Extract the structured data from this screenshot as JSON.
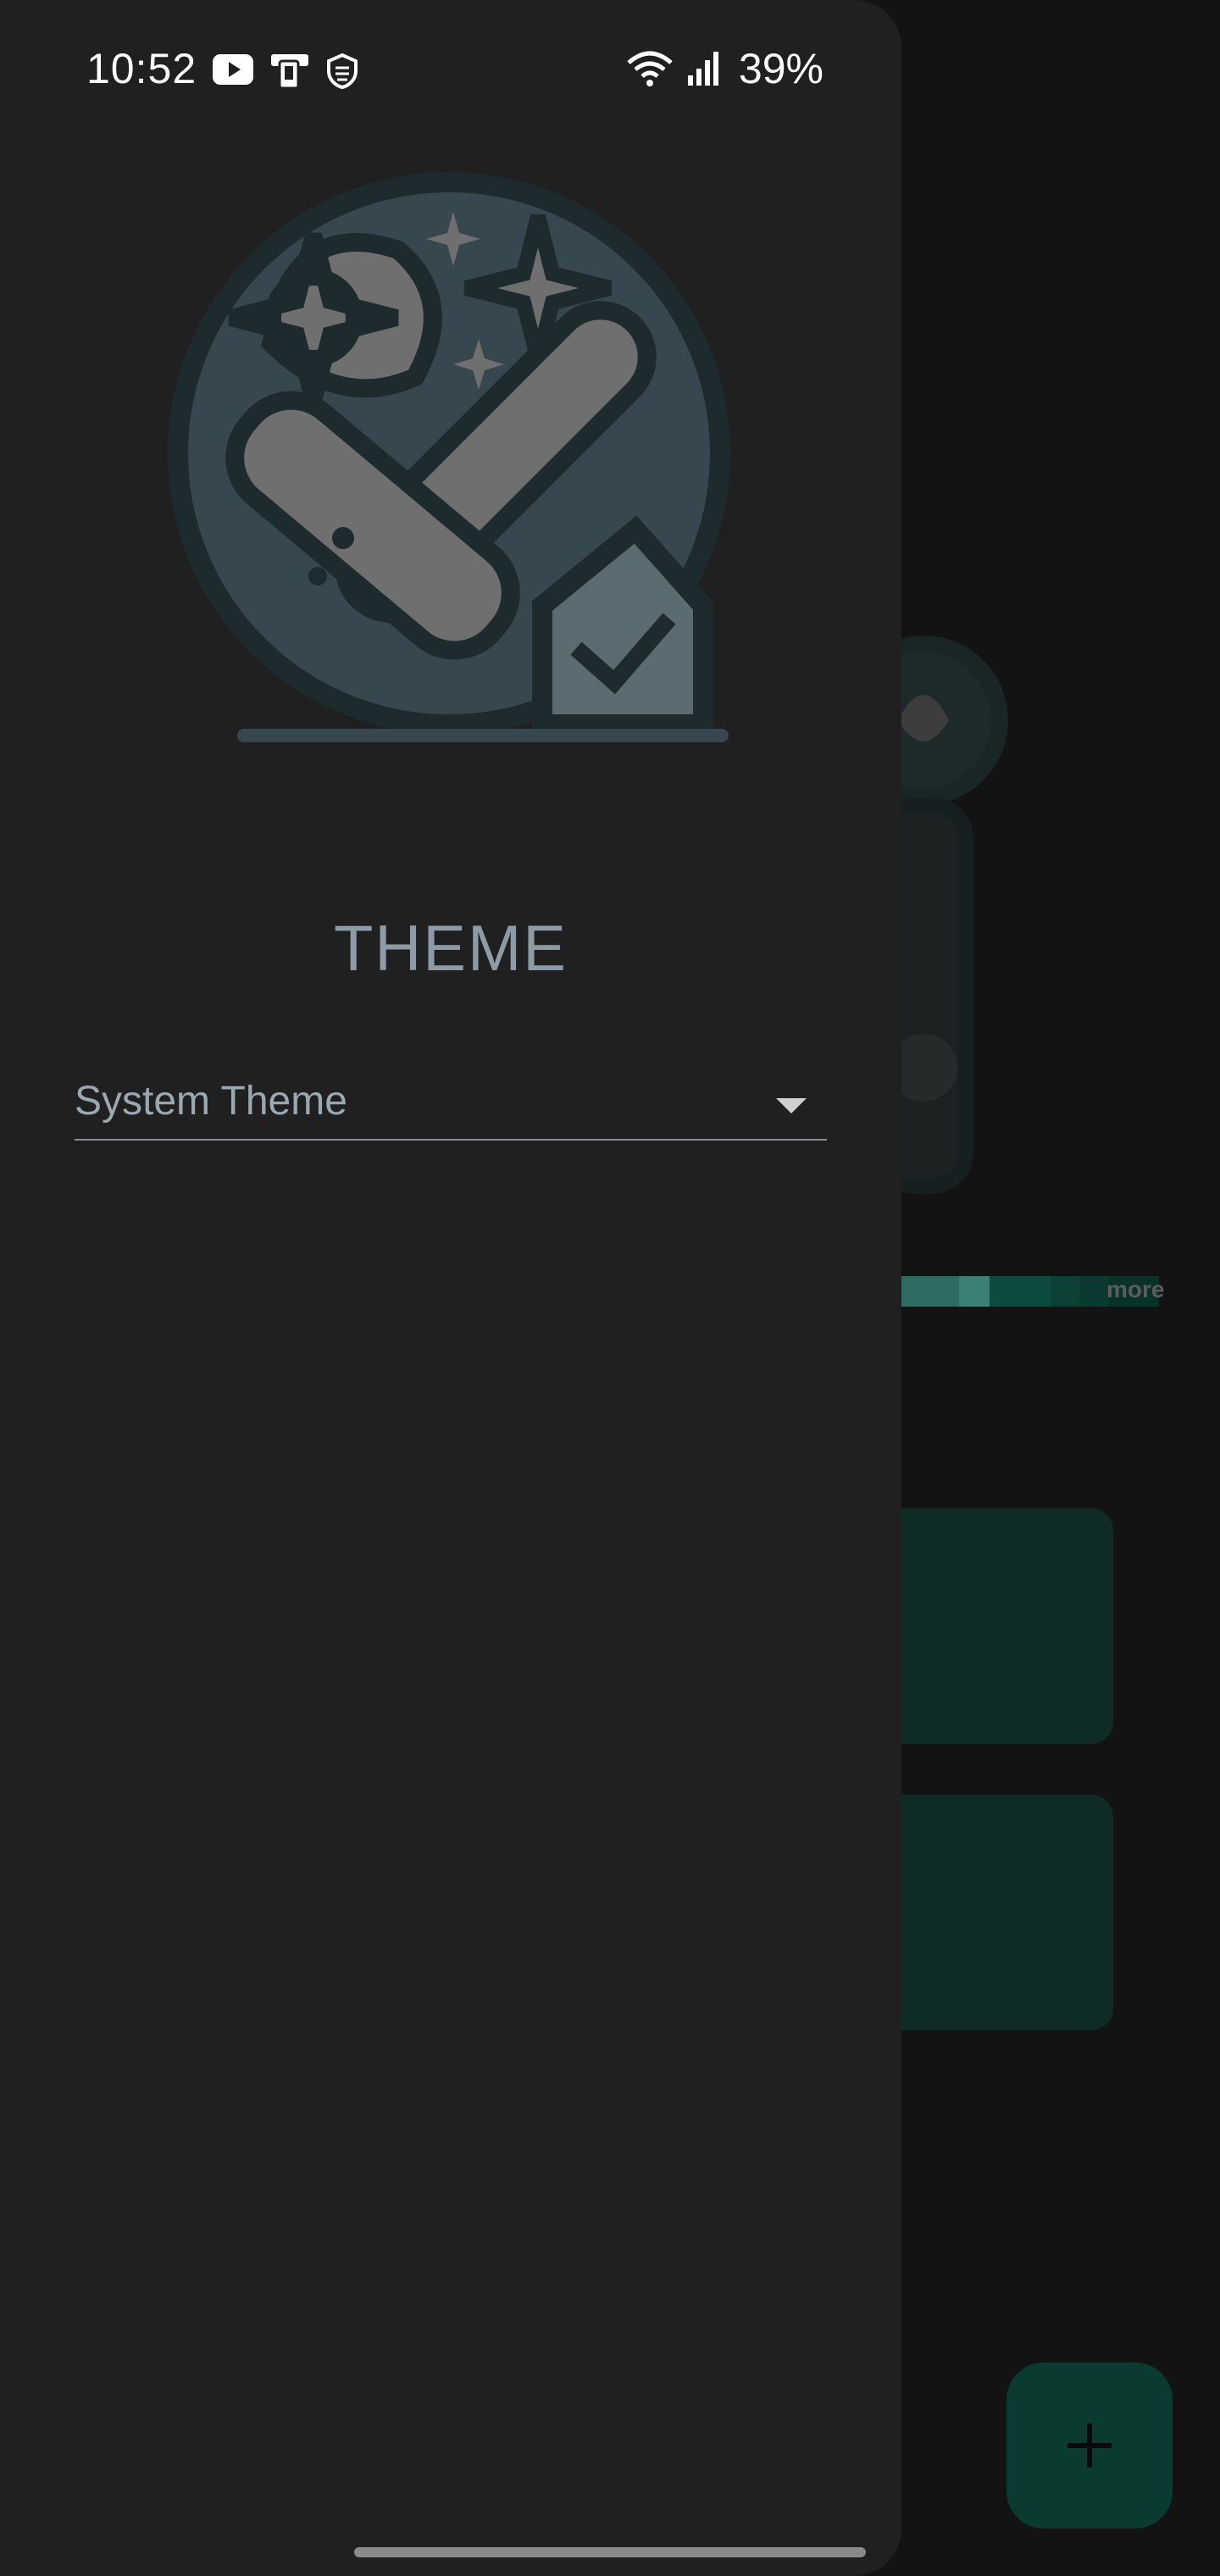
{
  "status_bar": {
    "time": "10:52",
    "left_icons": [
      "youtube-icon",
      "device-icon",
      "shield-icon"
    ],
    "right_icons": [
      "wifi-icon",
      "signal-icon"
    ],
    "battery": "39%"
  },
  "drawer": {
    "section_title": "THEME",
    "theme_select": {
      "value": "System Theme",
      "icon": "dropdown-arrow-icon"
    }
  },
  "background": {
    "more_label": "more",
    "fab_icon": "plus-icon",
    "accent": "#0b3a31",
    "strip_colors": [
      "#2e6c63",
      "#3b7f75",
      "#0e4b3f",
      "#0c4236",
      "#0a3a30",
      "#08332a"
    ]
  }
}
